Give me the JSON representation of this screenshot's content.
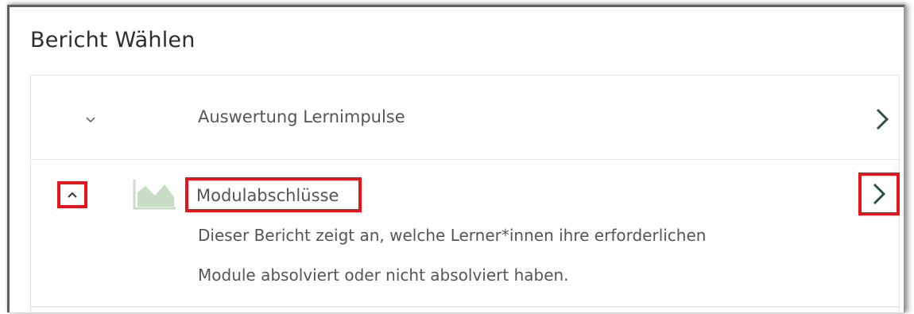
{
  "page": {
    "title": "Bericht Wählen"
  },
  "reports": [
    {
      "title": "Auswertung Lernimpulse",
      "expanded": false,
      "toggle_icon": "chevron-down-icon",
      "open_icon": "chevron-right-icon"
    },
    {
      "title": "Modulabschlüsse",
      "expanded": true,
      "toggle_icon": "chevron-up-icon",
      "open_icon": "chevron-right-icon",
      "report_icon": "area-chart-icon",
      "description_lines": [
        "Dieser Bericht zeigt an, welche Lerner*innen ihre erforderlichen",
        "Module absolviert oder nicht absolviert haben."
      ]
    }
  ],
  "colors": {
    "highlight": "#e8141b",
    "chevron": "#2f4f4f",
    "chart_icon": "#c9dcc6",
    "text": "#555555",
    "title": "#2d2d2d"
  }
}
